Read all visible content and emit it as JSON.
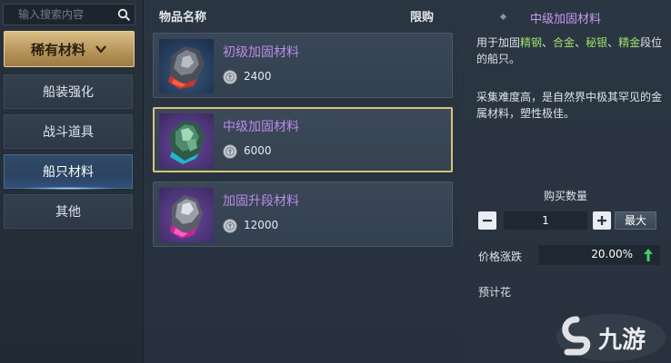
{
  "search": {
    "placeholder": "输入搜索内容",
    "icon": "search-icon"
  },
  "category": {
    "title": "稀有材料",
    "icon": "chevron-down-icon"
  },
  "sidebar": {
    "items": [
      {
        "label": "船装强化",
        "active": false
      },
      {
        "label": "战斗道具",
        "active": false
      },
      {
        "label": "船只材料",
        "active": true
      },
      {
        "label": "其他",
        "active": false
      }
    ]
  },
  "table": {
    "col_name": "物品名称",
    "col_limit": "限购"
  },
  "items": [
    {
      "name": "初级加固材料",
      "price": "2400",
      "name_color": "#b98be8",
      "selected": false,
      "icon": "dark-ore-icon"
    },
    {
      "name": "中级加固材料",
      "price": "6000",
      "name_color": "#b98be8",
      "selected": true,
      "icon": "green-crystal-ore-icon"
    },
    {
      "name": "加固升段材料",
      "price": "12000",
      "name_color": "#b98be8",
      "selected": false,
      "icon": "purple-crystal-ore-icon"
    }
  ],
  "detail": {
    "title": "中级加固材料",
    "desc1_prefix": "用于加固",
    "desc1_hl1": "精钢",
    "sep1": "、",
    "desc1_hl2": "合金",
    "sep2": "、",
    "desc1_hl3": "秘银",
    "sep3": "、",
    "desc1_hl4": "精金",
    "desc1_suffix": "段位的船只。",
    "desc2": "采集难度高，是自然界中极其罕见的金属材料，塑性极佳。",
    "qty_label": "购买数量",
    "qty_value": "1",
    "max_label": "最大",
    "price_change_label": "价格涨跌",
    "price_change_value": "20.00%",
    "est_label": "预计花"
  },
  "watermark": {
    "text": "九游"
  },
  "colors": {
    "accent_gold": "#d9c27b",
    "item_name": "#b98be8",
    "highlight_green": "#9ee36a",
    "up_arrow": "#3fd16a"
  }
}
